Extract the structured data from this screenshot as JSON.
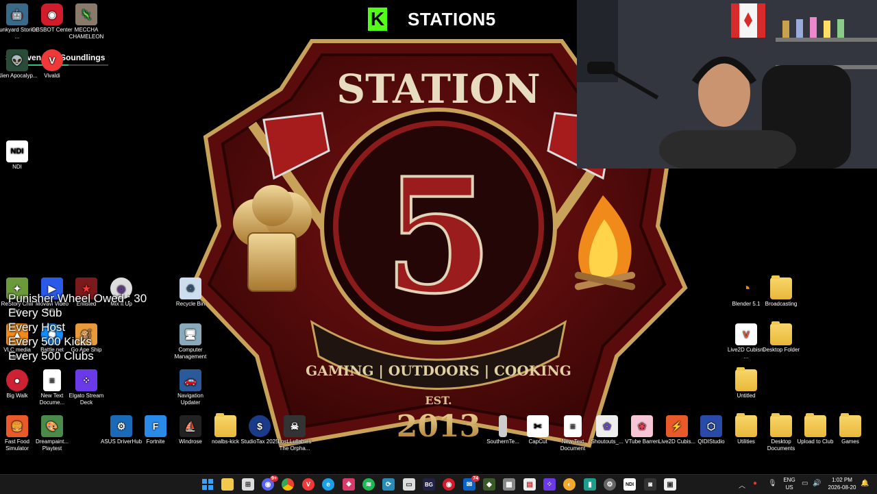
{
  "wallpaper": {
    "logo_title": "STATION",
    "logo_number": "5",
    "logo_tagline": "GAMING | OUTDOORS | COOKING",
    "logo_est": "EST.",
    "logo_year": "2013"
  },
  "stream_overlay": {
    "kick_logo": "K",
    "channel_name": "STATION5",
    "now_playing": "Sixseven The Soundlings",
    "now_playing_progress": 0.6,
    "wheel_lines": [
      "Punisher Wheel Owed : 30",
      "Every Sub",
      "Every Host",
      "Every 500 Kicks",
      "Every 500 Clubs"
    ]
  },
  "desktop_icons": {
    "junkyard": "Junkyard Stories ...",
    "obsbot": "OBSBOT Center",
    "meccha": "MECCHA CHAMELEON",
    "alien": "Alien Apocalyp...",
    "vivaldi": "Vivaldi",
    "ndi": "NDI",
    "restory": "ReStory Chill Elec...",
    "movavi": "Movavi Video Edit...",
    "enlisted": "Enlisted",
    "mixitup": "Mix It Up",
    "recycle": "Recycle Bin",
    "vlc": "VLC media player",
    "battlenet": "Battle.net",
    "goape": "Go Ape Ship",
    "computer_mgmt": "Computer Management",
    "bigwalk": "Big Walk",
    "newtext1": "New Text Docume...",
    "streamdeck": "Elgato Stream Deck",
    "nav_updater": "Navigation Updater",
    "fastfood": "Fast Food Simulator",
    "dreampaint": "Dreampaint... Playtest",
    "asus": "ASUS DriverHub",
    "fortnite": "Fortnite",
    "windrose": "Windrose",
    "noalbs": "noalbs-kick",
    "studiotax": "StudioTax 2025",
    "lostlullabies": "Lost Lullabies The Orpha...",
    "southern": "SouthernTe...",
    "capcut": "CapCut",
    "newtext2": "New Text Document",
    "shoutouts": "Shoutouts_...",
    "vtube": "VTube Barren",
    "live2d_cubis": "Live2D Cubis...",
    "qidi": "QIDIStudio",
    "utilities": "Utilities",
    "desktop_docs": "Desktop Documents",
    "upload_club": "Upload to Club",
    "games": "Games",
    "blender": "Blender 5.1",
    "broadcasting": "Broadcasting",
    "live2d_cubism": "Live2D Cubism ...",
    "desktop_folder": "Desktop Folder",
    "untitled": "Untitled"
  },
  "taskbar": {
    "discord_badge": "9+",
    "mail_badge": "74",
    "bg_label": "BG",
    "ndi_label": "NDI",
    "lang_line1": "ENG",
    "lang_line2": "US",
    "time": "1:02 PM",
    "date": "2026-08-20"
  },
  "colors": {
    "kick_green": "#53fc18",
    "logo_red": "#8b1a1a",
    "logo_gold": "#c9a25a",
    "taskbar_bg": "#1a1a1a"
  }
}
